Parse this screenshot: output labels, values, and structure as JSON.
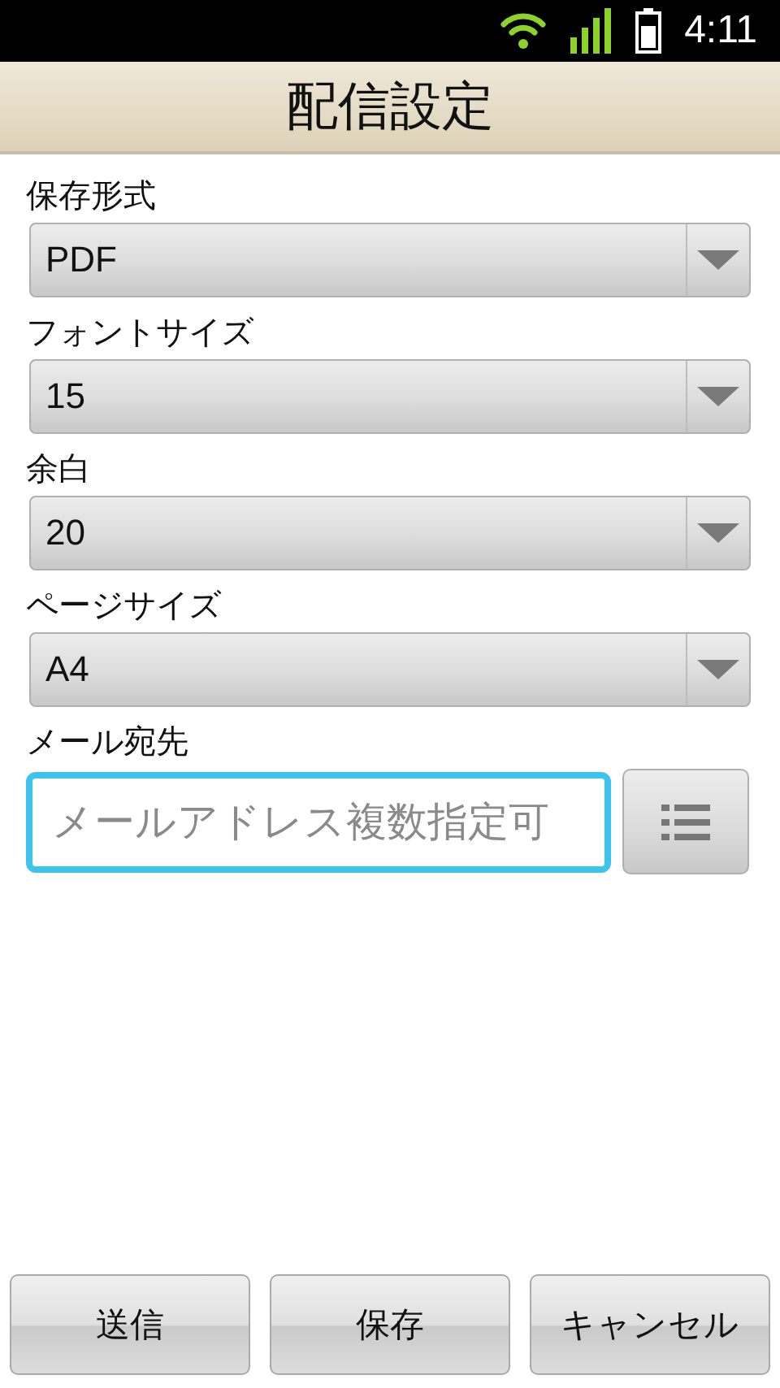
{
  "status_bar": {
    "time": "4:11"
  },
  "title": "配信設定",
  "settings": [
    {
      "label": "保存形式",
      "value": "PDF"
    },
    {
      "label": "フォントサイズ",
      "value": "15"
    },
    {
      "label": "余白",
      "value": "20"
    },
    {
      "label": "ページサイズ",
      "value": "A4"
    }
  ],
  "email": {
    "label": "メール宛先",
    "placeholder": "メールアドレス複数指定可",
    "focused": true
  },
  "buttons": [
    "送信",
    "保存",
    "キャンセル"
  ]
}
